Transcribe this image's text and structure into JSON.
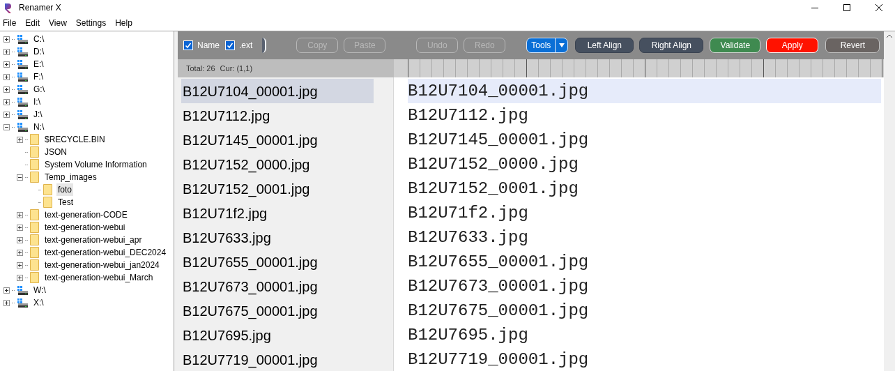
{
  "window": {
    "title": "Renamer X"
  },
  "menu": [
    "File",
    "Edit",
    "View",
    "Settings",
    "Help"
  ],
  "tree": [
    {
      "label": "C:\\",
      "kind": "drive",
      "expanded": false,
      "selected": false
    },
    {
      "label": "D:\\",
      "kind": "drive",
      "expanded": false,
      "selected": false
    },
    {
      "label": "E:\\",
      "kind": "drive",
      "expanded": false,
      "selected": false
    },
    {
      "label": "F:\\",
      "kind": "drive",
      "expanded": false,
      "selected": false
    },
    {
      "label": "G:\\",
      "kind": "drive",
      "expanded": false,
      "selected": false
    },
    {
      "label": "I:\\",
      "kind": "drive",
      "expanded": false,
      "selected": false
    },
    {
      "label": "J:\\",
      "kind": "drive",
      "expanded": false,
      "selected": false
    },
    {
      "label": "N:\\",
      "kind": "drive",
      "expanded": true,
      "selected": false,
      "children": [
        {
          "label": "$RECYCLE.BIN",
          "kind": "folder",
          "expanded": false,
          "selected": false
        },
        {
          "label": "JSON",
          "kind": "folder",
          "selected": false
        },
        {
          "label": "System Volume Information",
          "kind": "folder",
          "selected": false
        },
        {
          "label": "Temp_images",
          "kind": "folder",
          "expanded": true,
          "selected": false,
          "children": [
            {
              "label": "foto",
              "kind": "folder",
              "selected": true
            },
            {
              "label": "Test",
              "kind": "folder",
              "selected": false
            }
          ]
        },
        {
          "label": "text-generation-CODE",
          "kind": "folder",
          "expanded": false,
          "selected": false
        },
        {
          "label": "text-generation-webui",
          "kind": "folder",
          "expanded": false,
          "selected": false
        },
        {
          "label": "text-generation-webui_apr",
          "kind": "folder",
          "expanded": false,
          "selected": false
        },
        {
          "label": "text-generation-webui_DEC2024",
          "kind": "folder",
          "expanded": false,
          "selected": false
        },
        {
          "label": "text-generation-webui_jan2024",
          "kind": "folder",
          "expanded": false,
          "selected": false
        },
        {
          "label": "text-generation-webui_March",
          "kind": "folder",
          "expanded": false,
          "selected": false
        }
      ]
    },
    {
      "label": "W:\\",
      "kind": "drive",
      "expanded": false,
      "selected": false
    },
    {
      "label": "X:\\",
      "kind": "drive",
      "expanded": false,
      "selected": false
    }
  ],
  "toolbar": {
    "checkboxes": [
      {
        "label": "Name",
        "checked": true
      },
      {
        "label": ".ext",
        "checked": true
      }
    ],
    "buttons": [
      {
        "label": "Copy",
        "kind": "plain",
        "disabled": true
      },
      {
        "label": "Paste",
        "kind": "plain",
        "disabled": true
      },
      {
        "label": "Undo",
        "kind": "plain",
        "disabled": true
      },
      {
        "label": "Redo",
        "kind": "plain",
        "disabled": true
      },
      {
        "label": "Tools",
        "kind": "menu",
        "disabled": false
      },
      {
        "label": "Left Align",
        "kind": "slate",
        "disabled": false
      },
      {
        "label": "Right Align",
        "kind": "slate",
        "disabled": false
      },
      {
        "label": "Validate",
        "kind": "green",
        "disabled": false
      },
      {
        "label": "Apply",
        "kind": "red",
        "disabled": false
      },
      {
        "label": "Revert",
        "kind": "grey",
        "disabled": false
      }
    ]
  },
  "status": {
    "total": "Total: 26",
    "cursor": "Cur: (1,1)"
  },
  "files": [
    {
      "name": "B12U7104_00001.jpg",
      "selected": true
    },
    {
      "name": "B12U7112.jpg",
      "selected": false
    },
    {
      "name": "B12U7145_00001.jpg",
      "selected": false
    },
    {
      "name": "B12U7152_0000.jpg",
      "selected": false
    },
    {
      "name": "B12U7152_0001.jpg",
      "selected": false
    },
    {
      "name": "B12U71f2.jpg",
      "selected": false
    },
    {
      "name": "B12U7633.jpg",
      "selected": false
    },
    {
      "name": "B12U7655_00001.jpg",
      "selected": false
    },
    {
      "name": "B12U7673_00001.jpg",
      "selected": false
    },
    {
      "name": "B12U7675_00001.jpg",
      "selected": false
    },
    {
      "name": "B12U7695.jpg",
      "selected": false
    },
    {
      "name": "B12U7719_00001.jpg",
      "selected": false
    }
  ],
  "editor": [
    {
      "text": "B12U7104_00001.jpg",
      "selected": true
    },
    {
      "text": "B12U7112.jpg",
      "selected": false
    },
    {
      "text": "B12U7145_00001.jpg",
      "selected": false
    },
    {
      "text": "B12U7152_0000.jpg",
      "selected": false
    },
    {
      "text": "B12U7152_0001.jpg",
      "selected": false
    },
    {
      "text": "B12U71f2.jpg",
      "selected": false
    },
    {
      "text": "B12U7633.jpg",
      "selected": false
    },
    {
      "text": "B12U7655_00001.jpg",
      "selected": false
    },
    {
      "text": "B12U7673_00001.jpg",
      "selected": false
    },
    {
      "text": "B12U7675_00001.jpg",
      "selected": false
    },
    {
      "text": "B12U7695.jpg",
      "selected": false
    },
    {
      "text": "B12U7719_00001.jpg",
      "selected": false
    }
  ]
}
